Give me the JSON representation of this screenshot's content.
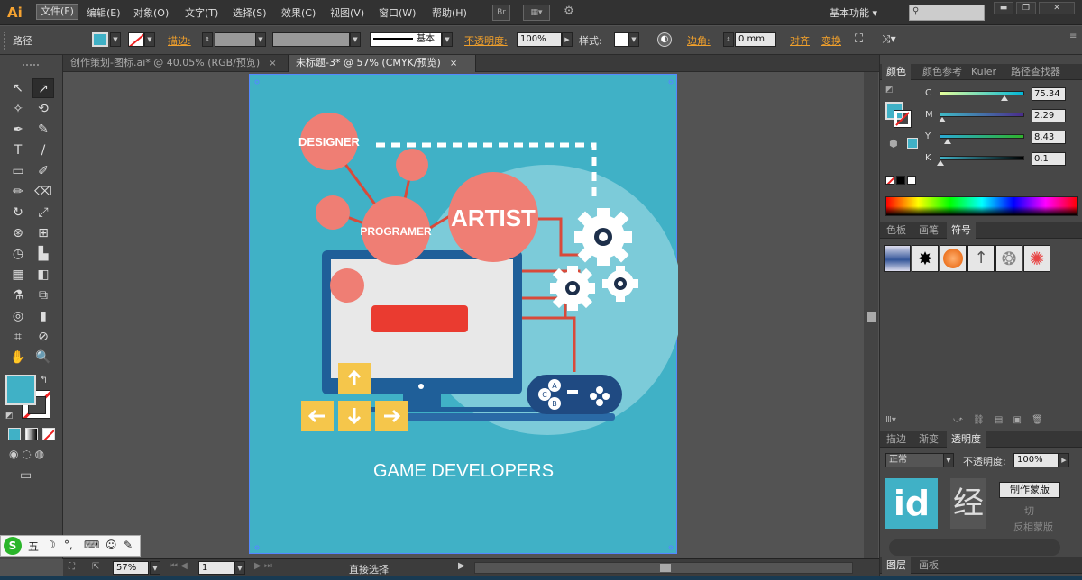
{
  "app": {
    "logo": "Ai"
  },
  "menu": [
    "文件(F)",
    "编辑(E)",
    "对象(O)",
    "文字(T)",
    "选择(S)",
    "效果(C)",
    "视图(V)",
    "窗口(W)",
    "帮助(H)"
  ],
  "menubar_buttons": {
    "br": "Br",
    "arrange": "▦▾",
    "gpu": "⚙"
  },
  "workspace": {
    "label": "基本功能",
    "arrow": "▾"
  },
  "window_controls": {
    "minimize": "▬",
    "restore": "❐",
    "close": "✕"
  },
  "control_bar": {
    "selection_label": "路径",
    "stroke_label": "描边:",
    "stroke_style": "基本",
    "opacity_label": "不透明度:",
    "opacity_value": "100%",
    "style_label": "样式:",
    "corner_label": "边角:",
    "corner_value": "0 mm",
    "align_label": "对齐",
    "transform_label": "变换"
  },
  "tabs": [
    {
      "label": "创作策划-图标.ai* @ 40.05% (RGB/预览)",
      "active": false
    },
    {
      "label": "未标题-3* @ 57% (CMYK/预览)",
      "active": true
    }
  ],
  "tab_close": "×",
  "tools": [
    "↖",
    "↗",
    "✧",
    "⟲",
    "✒",
    "✎",
    "T",
    "/",
    "▭",
    "✐",
    "✏",
    "⌫",
    "↻",
    "⤢",
    "⊛",
    "⊞",
    "◷",
    "▙",
    "▦",
    "◧",
    "⚗",
    "⧉",
    "◎",
    "▮",
    "⌗",
    "⊘",
    "✋",
    "🔍"
  ],
  "artwork": {
    "designer": "DESIGNER",
    "programer": "PROGRAMER",
    "artist": "ARTIST",
    "caption": "GAME DEVELOPERS",
    "controller_buttons": [
      "A",
      "C",
      "B"
    ]
  },
  "status": {
    "zoom": "57%",
    "page": "1",
    "tool": "直接选择"
  },
  "color_panel": {
    "tabs": [
      "颜色",
      "颜色参考",
      "Kuler",
      "路径查找器"
    ],
    "channels": [
      {
        "name": "C",
        "value": "75.34",
        "fraction": 0.7534,
        "gradient": "linear-gradient(90deg,#e6ff9c,#00b6d8)"
      },
      {
        "name": "M",
        "value": "2.29",
        "fraction": 0.0229,
        "gradient": "linear-gradient(90deg,#3fb9c6,#4a2b8a)"
      },
      {
        "name": "Y",
        "value": "8.43",
        "fraction": 0.0843,
        "gradient": "linear-gradient(90deg,#2aaad4,#2fb22b)"
      },
      {
        "name": "K",
        "value": "0.1",
        "fraction": 0.001,
        "gradient": "linear-gradient(90deg,#40b1c6,#000)"
      }
    ],
    "fill_color": "#40b1c6"
  },
  "symbols_panel": {
    "tabs": [
      "色板",
      "画笔",
      "符号"
    ]
  },
  "transparency_panel": {
    "tabs": [
      "描边",
      "渐变",
      "透明度"
    ],
    "mode": "正常",
    "opacity_label": "不透明度:",
    "opacity_value": "100%",
    "mask_button": "制作蒙版",
    "clip_label": "切",
    "invert_label": "反相蒙版"
  },
  "layers_panel": {
    "tabs": [
      "图层",
      "画板"
    ]
  },
  "ime": {
    "icon": "S",
    "mode": "五",
    "moon": "☽",
    "punct": "°,",
    "keyboard": "⌨",
    "user": "☺",
    "tools": "✎"
  },
  "watermark": "经"
}
